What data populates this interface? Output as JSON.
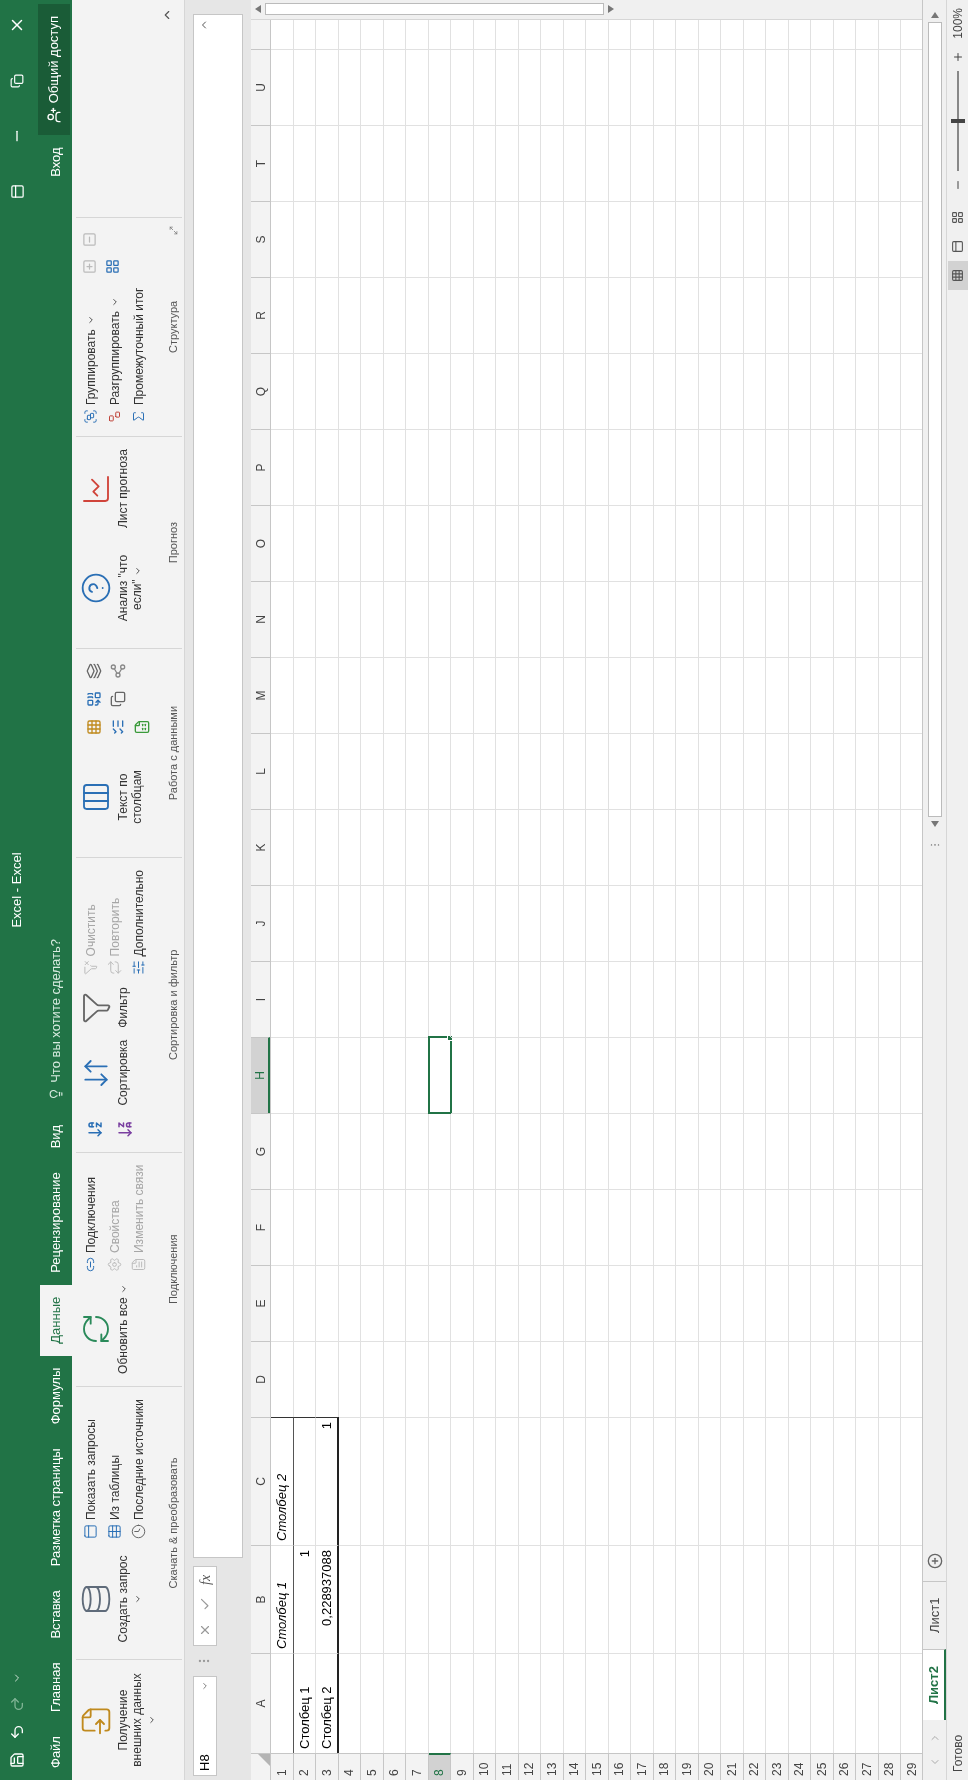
{
  "title_bar": {
    "title": "Excel - Excel"
  },
  "tabs": [
    {
      "label": "Файл",
      "selected": false
    },
    {
      "label": "Главная",
      "selected": false
    },
    {
      "label": "Вставка",
      "selected": false
    },
    {
      "label": "Разметка страницы",
      "selected": false
    },
    {
      "label": "Формулы",
      "selected": false
    },
    {
      "label": "Данные",
      "selected": true
    },
    {
      "label": "Рецензирование",
      "selected": false
    },
    {
      "label": "Вид",
      "selected": false
    }
  ],
  "search": {
    "placeholder": "Что вы хотите сделать?"
  },
  "account": {
    "sign_in": "Вход",
    "share": "Общий доступ"
  },
  "ribbon": {
    "groups": [
      {
        "dialog_launcher": false,
        "columns": [
          {
            "kind": "large",
            "label": "Получение внешних данных",
            "dropdown": true
          }
        ]
      },
      {
        "label": "Скачать & преобразовать",
        "dialog_launcher": false,
        "columns": [
          {
            "kind": "large",
            "label": "Создать запрос",
            "dropdown": true
          },
          {
            "kind": "stack",
            "items": [
              {
                "label": "Показать запросы",
                "disabled": false,
                "dropdown": false
              },
              {
                "label": "Из таблицы",
                "disabled": false,
                "dropdown": false
              },
              {
                "label": "Последние источники",
                "disabled": false,
                "dropdown": false
              }
            ]
          }
        ]
      },
      {
        "label": "Подключения",
        "dialog_launcher": false,
        "columns": [
          {
            "kind": "large",
            "label": "Обновить все",
            "dropdown": true
          },
          {
            "kind": "stack",
            "items": [
              {
                "label": "Подключения",
                "disabled": false,
                "dropdown": false
              },
              {
                "label": "Свойства",
                "disabled": true,
                "dropdown": false
              },
              {
                "label": "Изменить связи",
                "disabled": true,
                "dropdown": false
              }
            ]
          }
        ]
      },
      {
        "label": "Сортировка и фильтр",
        "dialog_launcher": false,
        "columns": [
          {
            "kind": "sort_icons"
          },
          {
            "kind": "large",
            "label": "Сортировка",
            "dropdown": false
          },
          {
            "kind": "large",
            "label": "Фильтр",
            "dropdown": false
          },
          {
            "kind": "stack",
            "items": [
              {
                "label": "Очистить",
                "disabled": true,
                "dropdown": false
              },
              {
                "label": "Повторить",
                "disabled": true,
                "dropdown": false
              },
              {
                "label": "Дополнительно",
                "disabled": false,
                "dropdown": false
              }
            ]
          }
        ]
      },
      {
        "label": "Работа с данными",
        "dialog_launcher": false,
        "columns": [
          {
            "kind": "large",
            "label": "Текст по столбцам",
            "dropdown": false
          },
          {
            "kind": "icon_grid"
          }
        ]
      },
      {
        "label": "Прогноз",
        "dialog_launcher": false,
        "columns": [
          {
            "kind": "large",
            "label": "Анализ \"что если\"",
            "dropdown": true
          },
          {
            "kind": "large",
            "label": "Лист прогноза",
            "dropdown": false
          }
        ]
      },
      {
        "label": "Структура",
        "dialog_launcher": true,
        "columns": [
          {
            "kind": "stack",
            "items": [
              {
                "label": "Группировать",
                "disabled": false,
                "dropdown": true
              },
              {
                "label": "Разгруппировать",
                "disabled": false,
                "dropdown": true
              },
              {
                "label": "Промежуточный итог",
                "disabled": false,
                "dropdown": false
              }
            ]
          },
          {
            "kind": "outline_icons"
          }
        ]
      }
    ]
  },
  "formula_bar": {
    "name_box": "H8",
    "function_label": "fx"
  },
  "sheet": {
    "columns": [
      {
        "label": "A",
        "selected": false
      },
      {
        "label": "B",
        "selected": false
      },
      {
        "label": "C",
        "selected": false
      },
      {
        "label": "D",
        "selected": false
      },
      {
        "label": "E",
        "selected": false
      },
      {
        "label": "F",
        "selected": false
      },
      {
        "label": "G",
        "selected": false
      },
      {
        "label": "H",
        "selected": true
      },
      {
        "label": "I",
        "selected": false
      },
      {
        "label": "J",
        "selected": false
      },
      {
        "label": "K",
        "selected": false
      },
      {
        "label": "L",
        "selected": false
      },
      {
        "label": "M",
        "selected": false
      },
      {
        "label": "N",
        "selected": false
      },
      {
        "label": "O",
        "selected": false
      },
      {
        "label": "P",
        "selected": false
      },
      {
        "label": "Q",
        "selected": false
      },
      {
        "label": "R",
        "selected": false
      },
      {
        "label": "S",
        "selected": false
      },
      {
        "label": "T",
        "selected": false
      },
      {
        "label": "U",
        "selected": false
      }
    ],
    "rows": [
      {
        "number": "1",
        "selected": false,
        "kind": "table_header",
        "cells": [
          {
            "kind": "empty"
          },
          {
            "kind": "text",
            "text": "Столбец 1",
            "italic": true
          },
          {
            "kind": "text",
            "text": "Столбец 2",
            "italic": true
          }
        ]
      },
      {
        "number": "2",
        "selected": false,
        "kind": "table_row",
        "cells": [
          {
            "kind": "text",
            "text": "Столбец 1",
            "italic": false
          },
          {
            "kind": "number",
            "text": "1",
            "italic": false
          },
          {
            "kind": "empty"
          }
        ]
      },
      {
        "number": "3",
        "selected": false,
        "kind": "table_last",
        "cells": [
          {
            "kind": "text",
            "text": "Столбец 2",
            "italic": false
          },
          {
            "kind": "number",
            "text": "0,228937088",
            "italic": false
          },
          {
            "kind": "number",
            "text": "1",
            "italic": false
          }
        ]
      },
      {
        "number": "4",
        "selected": false,
        "kind": "plain"
      },
      {
        "number": "5",
        "selected": false,
        "kind": "plain"
      },
      {
        "number": "6",
        "selected": false,
        "kind": "plain"
      },
      {
        "number": "7",
        "selected": false,
        "kind": "plain"
      },
      {
        "number": "8",
        "selected": true,
        "kind": "plain"
      },
      {
        "number": "9",
        "selected": false,
        "kind": "plain"
      },
      {
        "number": "10",
        "selected": false,
        "kind": "plain"
      },
      {
        "number": "11",
        "selected": false,
        "kind": "plain"
      },
      {
        "number": "12",
        "selected": false,
        "kind": "plain"
      },
      {
        "number": "13",
        "selected": false,
        "kind": "plain"
      },
      {
        "number": "14",
        "selected": false,
        "kind": "plain"
      },
      {
        "number": "15",
        "selected": false,
        "kind": "plain"
      },
      {
        "number": "16",
        "selected": false,
        "kind": "plain"
      },
      {
        "number": "17",
        "selected": false,
        "kind": "plain"
      },
      {
        "number": "18",
        "selected": false,
        "kind": "plain"
      },
      {
        "number": "19",
        "selected": false,
        "kind": "plain"
      },
      {
        "number": "20",
        "selected": false,
        "kind": "plain"
      },
      {
        "number": "21",
        "selected": false,
        "kind": "plain"
      },
      {
        "number": "22",
        "selected": false,
        "kind": "plain"
      },
      {
        "number": "23",
        "selected": false,
        "kind": "plain"
      },
      {
        "number": "24",
        "selected": false,
        "kind": "plain"
      },
      {
        "number": "25",
        "selected": false,
        "kind": "plain"
      },
      {
        "number": "26",
        "selected": false,
        "kind": "plain"
      },
      {
        "number": "27",
        "selected": false,
        "kind": "plain"
      },
      {
        "number": "28",
        "selected": false,
        "kind": "plain"
      },
      {
        "number": "29",
        "selected": false,
        "kind": "plain"
      }
    ]
  },
  "sheet_tabs": [
    {
      "label": "Лист2",
      "selected": true
    },
    {
      "label": "Лист1",
      "selected": false
    }
  ],
  "status_bar": {
    "text": "Готово",
    "views": [
      {
        "selected": true
      },
      {
        "selected": false
      },
      {
        "selected": false
      }
    ],
    "zoom_slider": {
      "level": 0.5
    },
    "zoom": "100%"
  }
}
